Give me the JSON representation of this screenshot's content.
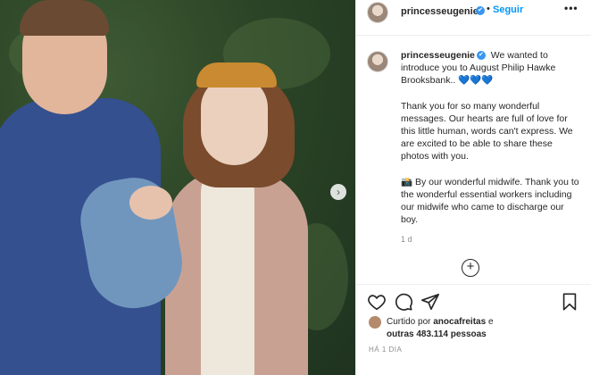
{
  "post": {
    "username": "princesseugenie",
    "verified_mark": "✔",
    "dot": "•",
    "follow_label": "Seguir",
    "more_label": "•••",
    "carousel_next": "›"
  },
  "caption": {
    "username": "princesseugenie",
    "line1": "We wanted to introduce you to August Philip Hawke Brooksbank..",
    "hearts": "💙💙💙",
    "para2": "Thank you for so many wonderful messages. Our hearts are full of love for this little human, words can't express. We are excited to be able to share these photos with you.",
    "para3_icon": "📸",
    "para3": "By our wonderful midwife. Thank you to the wonderful essential workers including our midwife who came to discharge our boy.",
    "time": "1 d"
  },
  "add_comment_icon": "+",
  "likes": {
    "prefix": "Curtido por",
    "user": "anocafreitas",
    "conj": "e",
    "others": "outras 483.114 pessoas"
  },
  "posted_ago": "HÁ 1 DIA",
  "icons": [
    "heart-icon",
    "comment-icon",
    "share-icon",
    "bookmark-icon",
    "verified-badge-icon",
    "more-options-icon",
    "add-comment-icon",
    "carousel-next-icon"
  ],
  "colors": {
    "accent": "#0095f6",
    "verified": "#3897f0",
    "text": "#262626",
    "muted": "#8e8e8e"
  }
}
